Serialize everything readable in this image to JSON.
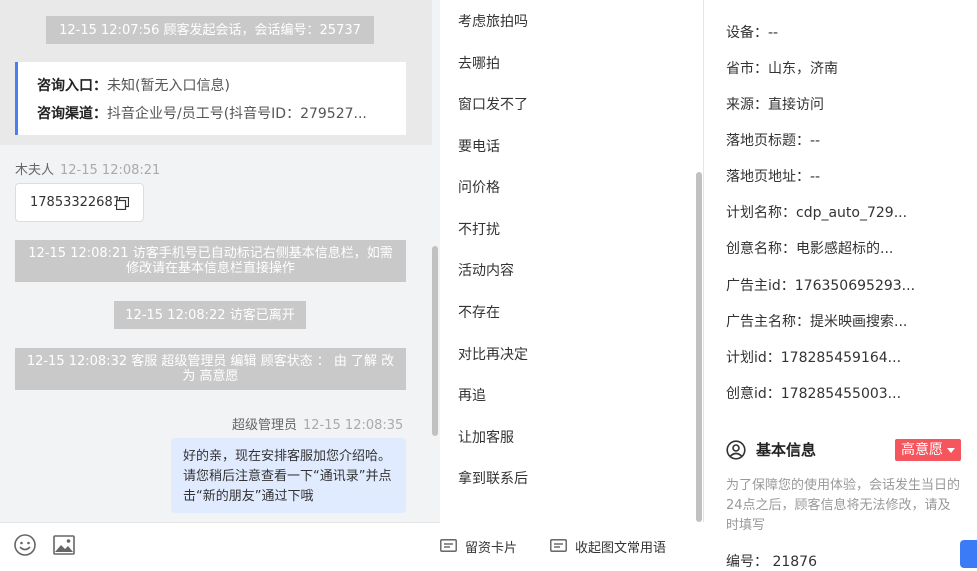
{
  "chat": {
    "session_start": "12-15 12:07:56 顾客发起会话，会话编号：25737",
    "entry_label": "咨询入口：",
    "entry_value": "未知(暂无入口信息)",
    "channel_label": "咨询渠道：",
    "channel_value": "抖音企业号/员工号(抖音号ID：279527...",
    "visitor_name": "木夫人",
    "visitor_time": "12-15 12:08:21",
    "phone": "17853322681",
    "sys_phone_marked": "12-15 12:08:21 访客手机号已自动标记右侧基本信息栏，如需修改请在基本信息栏直接操作",
    "sys_left": "12-15 12:08:22 访客已离开",
    "sys_status": "12-15 12:08:32 客服 超级管理员 编辑 顾客状态 ： 由 了解 改为 高意愿",
    "agent_name": "超级管理员",
    "agent_time": "12-15 12:08:35",
    "agent_message": "好的亲，现在安排客服加您介绍哈。请您稍后注意查看一下“通讯录”并点击“新的朋友”通过下哦"
  },
  "quick_replies": [
    "考虑旅拍吗",
    "去哪拍",
    "窗口发不了",
    "要电话",
    "问价格",
    "不打扰",
    "活动内容",
    "不存在",
    "对比再决定",
    "再追",
    "让加客服",
    "拿到联系后"
  ],
  "toolbar": {
    "card_label": "留资卡片",
    "collapse_label": "收起图文常用语"
  },
  "info": {
    "device": "设备：--",
    "city": "省市：山东，济南",
    "source": "来源：直接访问",
    "landing_title": "落地页标题：--",
    "landing_url": "落地页地址：--",
    "plan_name": "计划名称：cdp_auto_729...",
    "creative_name": "创意名称：电影感超标的...",
    "advertiser_id": "广告主id：176350695293...",
    "advertiser_name": "广告主名称：提米映画搜索...",
    "plan_id": "计划id：178285459164...",
    "creative_id": "创意id：178285455003...",
    "basic_info_title": "基本信息",
    "intent_tag": "高意愿",
    "notice": "为了保障您的使用体验，会话发生当日的24点之后，顾客信息将无法修改，请及时填写",
    "number": "编号：  21876"
  },
  "colors": {
    "accent": "#4a7ef3",
    "intent_red": "#f5555c",
    "agent_bubble": "#e1ebff",
    "system_gray": "#c9c9c9"
  }
}
